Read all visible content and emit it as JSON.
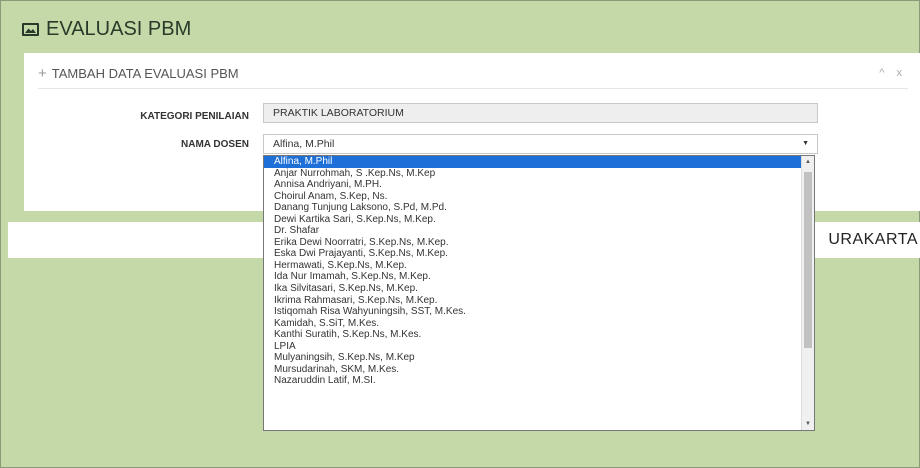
{
  "page": {
    "title": "EVALUASI PBM",
    "band_text": "URAKARTA"
  },
  "panel": {
    "title": "TAMBAH DATA EVALUASI PBM",
    "tools": {
      "collapse": "^",
      "close": "x"
    }
  },
  "form": {
    "kategori": {
      "label": "KATEGORI PENILAIAN",
      "value": "PRAKTIK LABORATORIUM"
    },
    "dosen": {
      "label": "NAMA DOSEN",
      "value": "Alfina, M.Phil",
      "caret": "▼"
    }
  },
  "dropdown": {
    "selected_index": 0,
    "options": [
      "Alfina, M.Phil",
      "Anjar Nurrohmah, S .Kep.Ns, M.Kep",
      "Annisa Andriyani, M.PH.",
      "Choirul Anam, S.Kep, Ns.",
      "Danang Tunjung Laksono, S.Pd, M.Pd.",
      "Dewi Kartika Sari, S.Kep.Ns, M.Kep.",
      "Dr. Shafar",
      "Erika Dewi Noorratri, S.Kep.Ns, M.Kep.",
      "Eska Dwi Prajayanti, S.Kep.Ns, M.Kep.",
      "Hermawati, S.Kep.Ns, M.Kep.",
      "Ida Nur Imamah, S.Kep.Ns, M.Kep.",
      "Ika Silvitasari, S.Kep.Ns, M.Kep.",
      "Ikrima Rahmasari, S.Kep.Ns, M.Kep.",
      "Istiqomah Risa Wahyuningsih, SST, M.Kes.",
      "Kamidah, S.SiT, M.Kes.",
      "Kanthi Suratih, S.Kep.Ns, M.Kes.",
      "LPIA",
      "Mulyaningsih, S.Kep.Ns, M.Kep",
      "Mursudarinah, SKM, M.Kes.",
      "Nazaruddin Latif, M.SI."
    ],
    "scroll_up": "▲",
    "scroll_down": "▼"
  }
}
